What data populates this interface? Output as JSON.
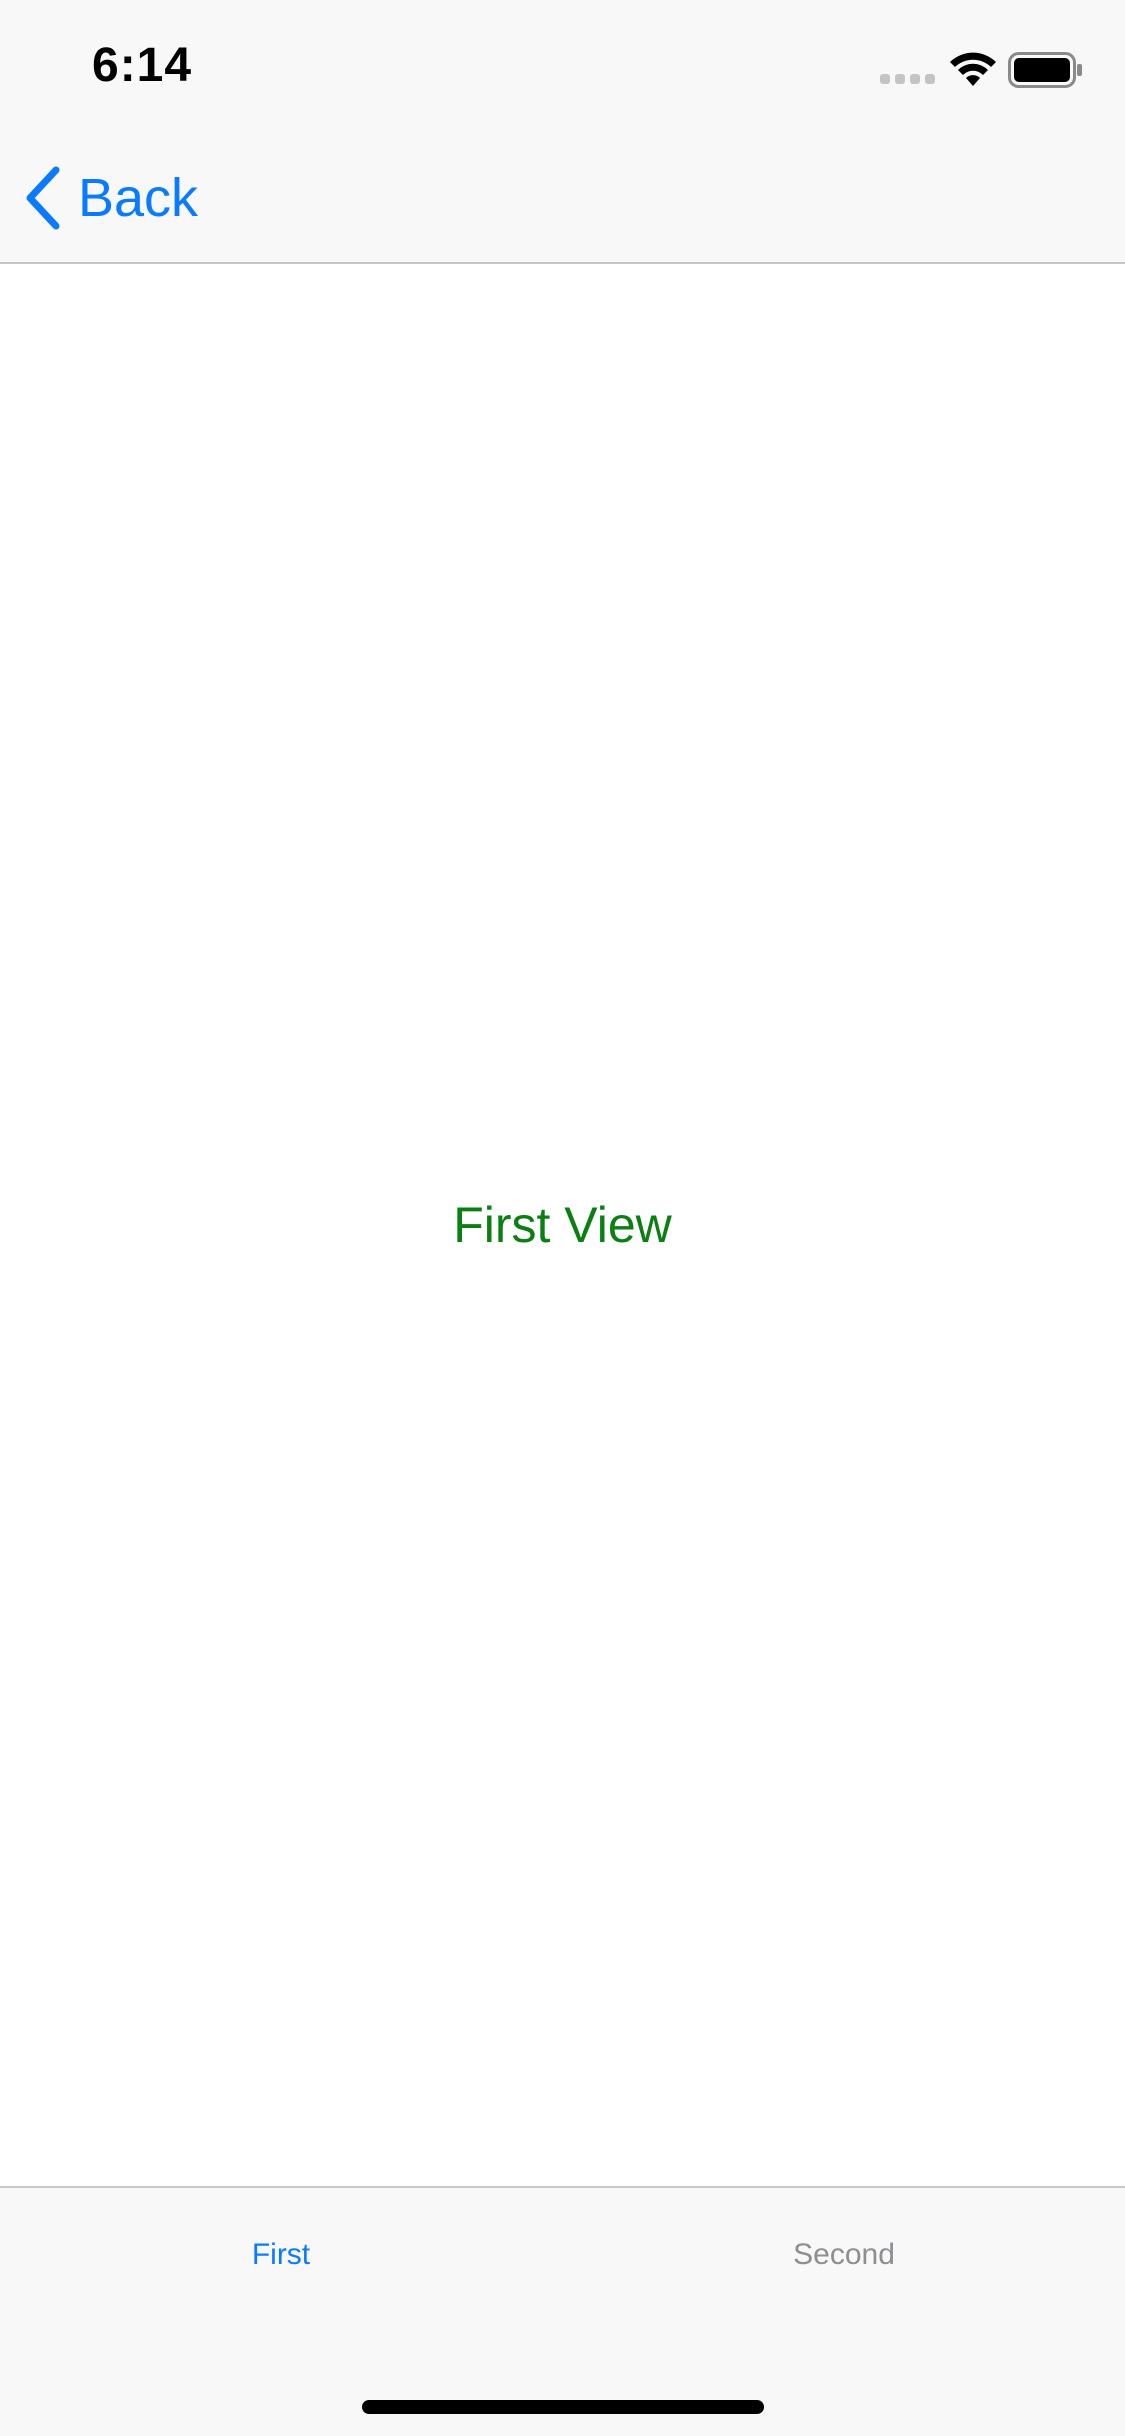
{
  "status_bar": {
    "time": "6:14",
    "signal_icon": "cellular-signal-icon",
    "wifi_icon": "wifi-icon",
    "battery_icon": "battery-icon"
  },
  "nav_bar": {
    "back_label": "Back",
    "back_icon": "chevron-left-icon",
    "accent_color": "#0a7aff"
  },
  "content": {
    "title": "First View",
    "title_color": "#0b7f12"
  },
  "tab_bar": {
    "tabs": [
      {
        "label": "First",
        "selected": true
      },
      {
        "label": "Second",
        "selected": false
      }
    ],
    "selected_color": "#0a7aff",
    "unselected_color": "#8e8e93"
  }
}
